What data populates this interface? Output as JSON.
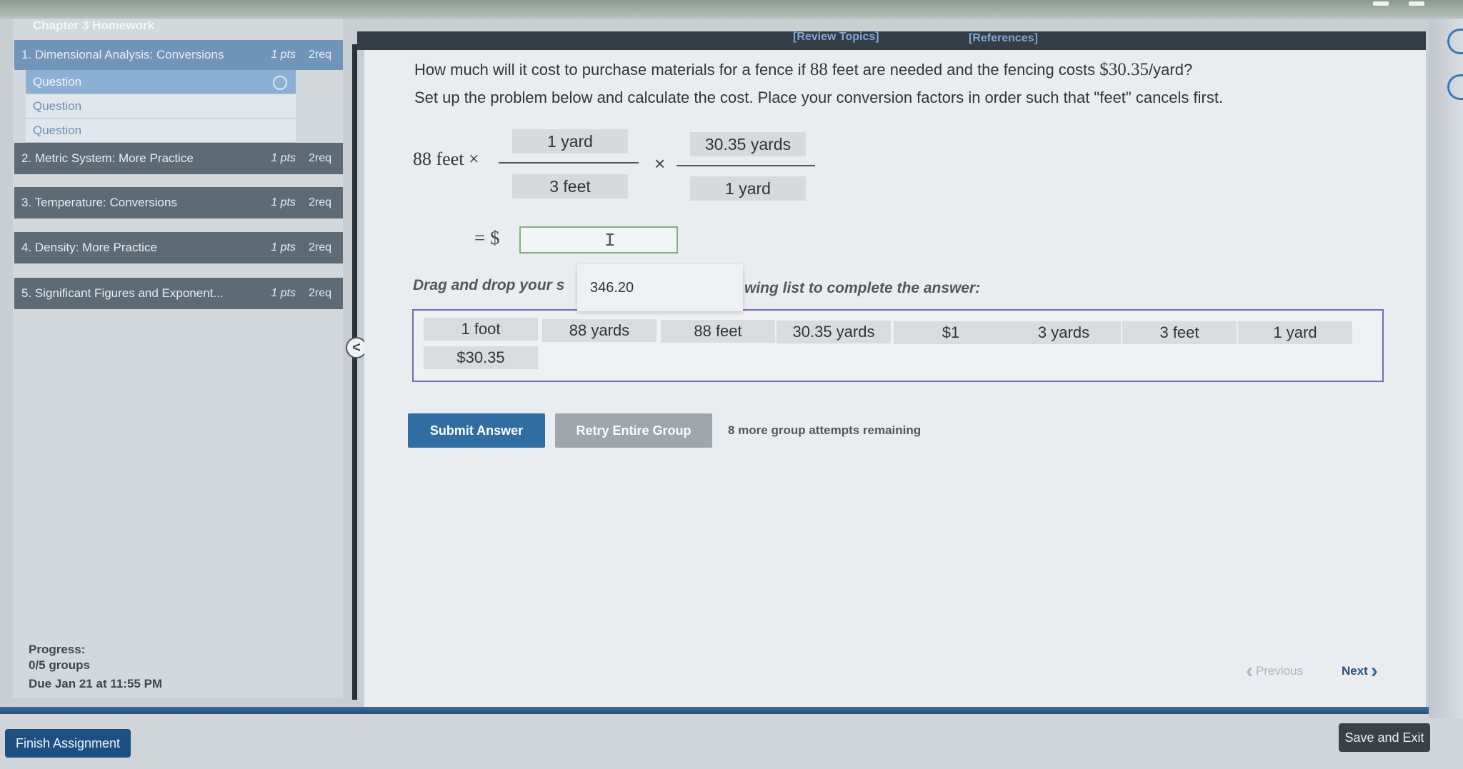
{
  "assignment": {
    "title": "Chapter 3 Homework",
    "progress_label": "Progress:",
    "progress_value": "0/5 groups",
    "due": "Due Jan 21 at 11:55 PM"
  },
  "sidebar": {
    "items": [
      {
        "label": "1. Dimensional Analysis: Conversions",
        "pts": "1 pts",
        "req": "2req"
      },
      {
        "label": "2. Metric System: More Practice",
        "pts": "1 pts",
        "req": "2req"
      },
      {
        "label": "3. Temperature: Conversions",
        "pts": "1 pts",
        "req": "2req"
      },
      {
        "label": "4. Density: More Practice",
        "pts": "1 pts",
        "req": "2req"
      },
      {
        "label": "5. Significant Figures and Exponent...",
        "pts": "1 pts",
        "req": "2req"
      }
    ],
    "sub_items": [
      "Question",
      "Question",
      "Question"
    ],
    "collapse_label": "<"
  },
  "header": {
    "review_topics": "[Review Topics]",
    "references": "[References]"
  },
  "question": {
    "line1_pre": "How much will it cost to purchase materials for a fence if ",
    "line1_num1": "88",
    "line1_mid": " feet are needed and the fencing costs ",
    "line1_num2": "$30.35",
    "line1_post": "/yard?",
    "line2": "Set up the problem below and calculate the cost. Place your conversion factors in order such that \"feet\" cancels first.",
    "start_quantity": "88 feet ×",
    "times": "×",
    "frac1_num": "1 yard",
    "frac1_den": "3 feet",
    "frac2_num": "30.35 yards",
    "frac2_den": "1 yard",
    "equals": "= $",
    "answer_value": ""
  },
  "drag": {
    "instruction_start": "Drag and drop your s",
    "instruction_end": "wing list to complete the answer:",
    "dragging_tile": "346.20",
    "options": [
      "1 foot",
      "88 yards",
      "88 feet",
      "30.35 yards",
      "$1",
      "3 yards",
      "3 feet",
      "1 yard",
      "$30.35"
    ]
  },
  "actions": {
    "submit": "Submit Answer",
    "retry": "Retry Entire Group",
    "attempts": "8 more group attempts remaining"
  },
  "nav": {
    "previous": "Previous",
    "next": "Next"
  },
  "footer": {
    "finish": "Finish Assignment",
    "save_exit": "Save and Exit"
  }
}
